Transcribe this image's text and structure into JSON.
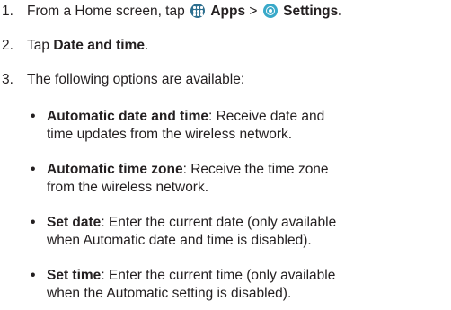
{
  "steps": [
    {
      "number": "1.",
      "prefix": "From a Home screen, tap",
      "apps_label": "Apps",
      "separator": ">",
      "settings_label": "Settings."
    },
    {
      "number": "2.",
      "prefix": "Tap",
      "bold": "Date and time",
      "suffix": "."
    },
    {
      "number": "3.",
      "text": "The following options are available:"
    }
  ],
  "options": [
    {
      "bullet": "•",
      "term": "Automatic date and time",
      "line1_rest": ": Receive date and",
      "line2": "time updates from the wireless network."
    },
    {
      "bullet": "•",
      "term": "Automatic time zone",
      "line1_rest": ": Receive the time zone",
      "line2": "from the wireless network."
    },
    {
      "bullet": "•",
      "term": "Set date",
      "line1_rest": ": Enter the current date (only available",
      "line2": "when Automatic date and time is disabled)."
    },
    {
      "bullet": "•",
      "term": "Set time",
      "line1_rest": ": Enter the current time (only available",
      "line2": "when the Automatic setting is disabled)."
    }
  ],
  "icons": {
    "apps": "apps-grid-icon",
    "settings": "settings-gear-icon"
  },
  "colors": {
    "text": "#231f20",
    "apps_icon": "#2e6f8f",
    "settings_icon": "#39a9c9"
  }
}
